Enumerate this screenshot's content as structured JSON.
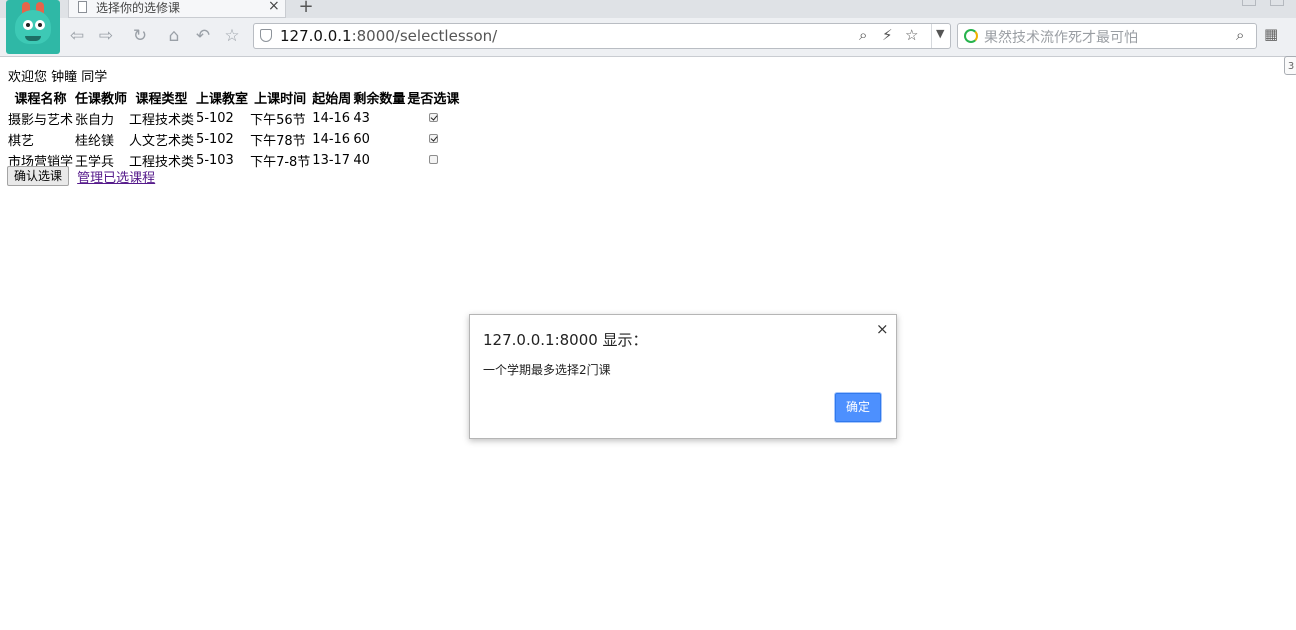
{
  "browser": {
    "tab_title": "选择你的选修课",
    "tab_close": "×",
    "new_tab": "+",
    "url_host": "127.0.0.1",
    "url_rest": ":8000/selectlesson/",
    "search_placeholder": "果然技术流作死才最可怕",
    "side_badge": "3"
  },
  "page": {
    "welcome": "欢迎您 钟瞳 同学",
    "columns": [
      "课程名称",
      "任课教师",
      "课程类型",
      "上课教室",
      "上课时间",
      "起始周",
      "剩余数量",
      "是否选课"
    ],
    "rows": [
      {
        "name": "摄影与艺术",
        "teacher": "张自力",
        "type": "工程技术类",
        "room": "5-102",
        "time": "下午56节",
        "weeks": "14-16",
        "remaining": "43",
        "selected": true
      },
      {
        "name": "棋艺",
        "teacher": "桂纶镁",
        "type": "人文艺术类",
        "room": "5-102",
        "time": "下午78节",
        "weeks": "14-16",
        "remaining": "60",
        "selected": true
      },
      {
        "name": "市场营销学",
        "teacher": "王学兵",
        "type": "工程技术类",
        "room": "5-103",
        "time": "下午7-8节",
        "weeks": "13-17",
        "remaining": "40",
        "selected": false
      }
    ],
    "confirm_button": "确认选课",
    "manage_link": "管理已选课程"
  },
  "dialog": {
    "title": "127.0.0.1:8000 显示：",
    "message": "一个学期最多选择2门课",
    "ok_button": "确定",
    "close": "×"
  },
  "colors": {
    "ok_button": "#4d90fe",
    "link_visited": "#551a8b",
    "avatar": "#2fb8a6"
  }
}
